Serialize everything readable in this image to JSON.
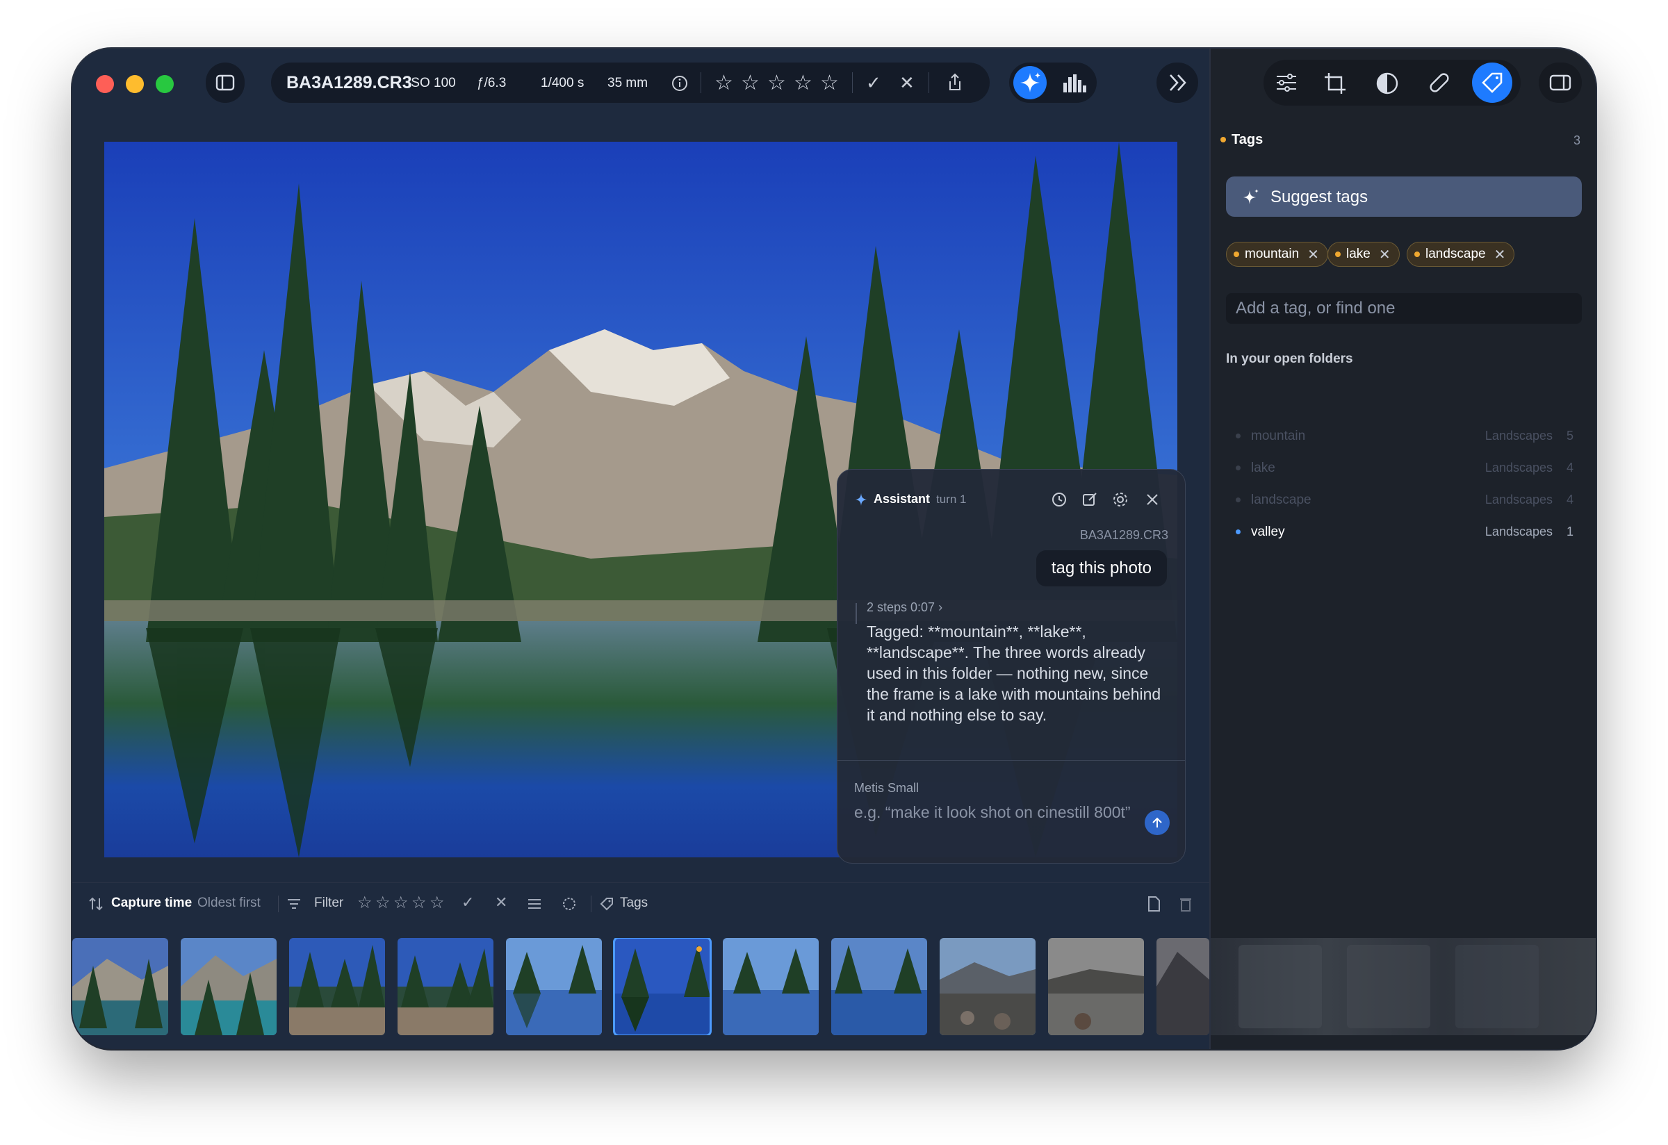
{
  "toolbar": {
    "filename": "BA3A1289.CR3",
    "iso": "ISO 100",
    "aperture": "ƒ/6.3",
    "shutter": "1/400 s",
    "focal": "35 mm",
    "stars": [
      "☆",
      "☆",
      "☆",
      "☆",
      "☆"
    ],
    "accept": "✓",
    "reject": "✕"
  },
  "assistant": {
    "title": "Assistant",
    "turn": "turn 1",
    "filename": "BA3A1289.CR3",
    "user_message": "tag this photo",
    "steps": "2 steps 0:07",
    "reply": "Tagged: **mountain**, **lake**, **landscape**. The three words already used in this folder — nothing new, since the frame is a lake with mountains behind it and nothing else to say.",
    "model": "Metis Small",
    "input_placeholder": "e.g. “make it look shot on cinestill 800t”"
  },
  "filterbar": {
    "sort_label": "Capture time",
    "sort_order": "Oldest first",
    "filter_label": "Filter",
    "stars": [
      "☆",
      "☆",
      "☆",
      "☆",
      "☆"
    ],
    "accept": "✓",
    "reject": "✕",
    "tags_label": "Tags"
  },
  "tags_panel": {
    "title": "Tags",
    "count": "3",
    "suggest_label": "Suggest tags",
    "applied_tags": [
      "mountain",
      "lake",
      "landscape"
    ],
    "add_placeholder": "Add a tag, or find one",
    "section_label": "In your open folders",
    "folder_tags": [
      {
        "name": "mountain",
        "folder": "Landscapes",
        "count": "5"
      },
      {
        "name": "lake",
        "folder": "Landscapes",
        "count": "4"
      },
      {
        "name": "landscape",
        "folder": "Landscapes",
        "count": "4"
      },
      {
        "name": "valley",
        "folder": "Landscapes",
        "count": "1"
      }
    ]
  },
  "colors": {
    "accent": "#1e7bff",
    "tag_dot": "#f0a830",
    "window_bg": "#1e2a3e"
  }
}
